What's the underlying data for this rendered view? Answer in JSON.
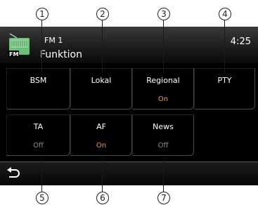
{
  "callouts": [
    "1",
    "2",
    "3",
    "4",
    "5",
    "6",
    "7"
  ],
  "header": {
    "band_label": "FM  1",
    "title": "Funktion",
    "clock": "4:25",
    "icon_text": "FM"
  },
  "buttons": [
    {
      "label": "BSM",
      "value": ""
    },
    {
      "label": "Lokal",
      "value": ""
    },
    {
      "label": "Regional",
      "value": "On"
    },
    {
      "label": "PTY",
      "value": ""
    },
    {
      "label": "TA",
      "value": "Off"
    },
    {
      "label": "AF",
      "value": "On"
    },
    {
      "label": "News",
      "value": "Off"
    }
  ],
  "colors": {
    "on": "#e5a020",
    "off": "#8a8a8a",
    "icon_green": "#6cc07a"
  },
  "footer": {
    "back_icon": "back-arrow-icon"
  }
}
